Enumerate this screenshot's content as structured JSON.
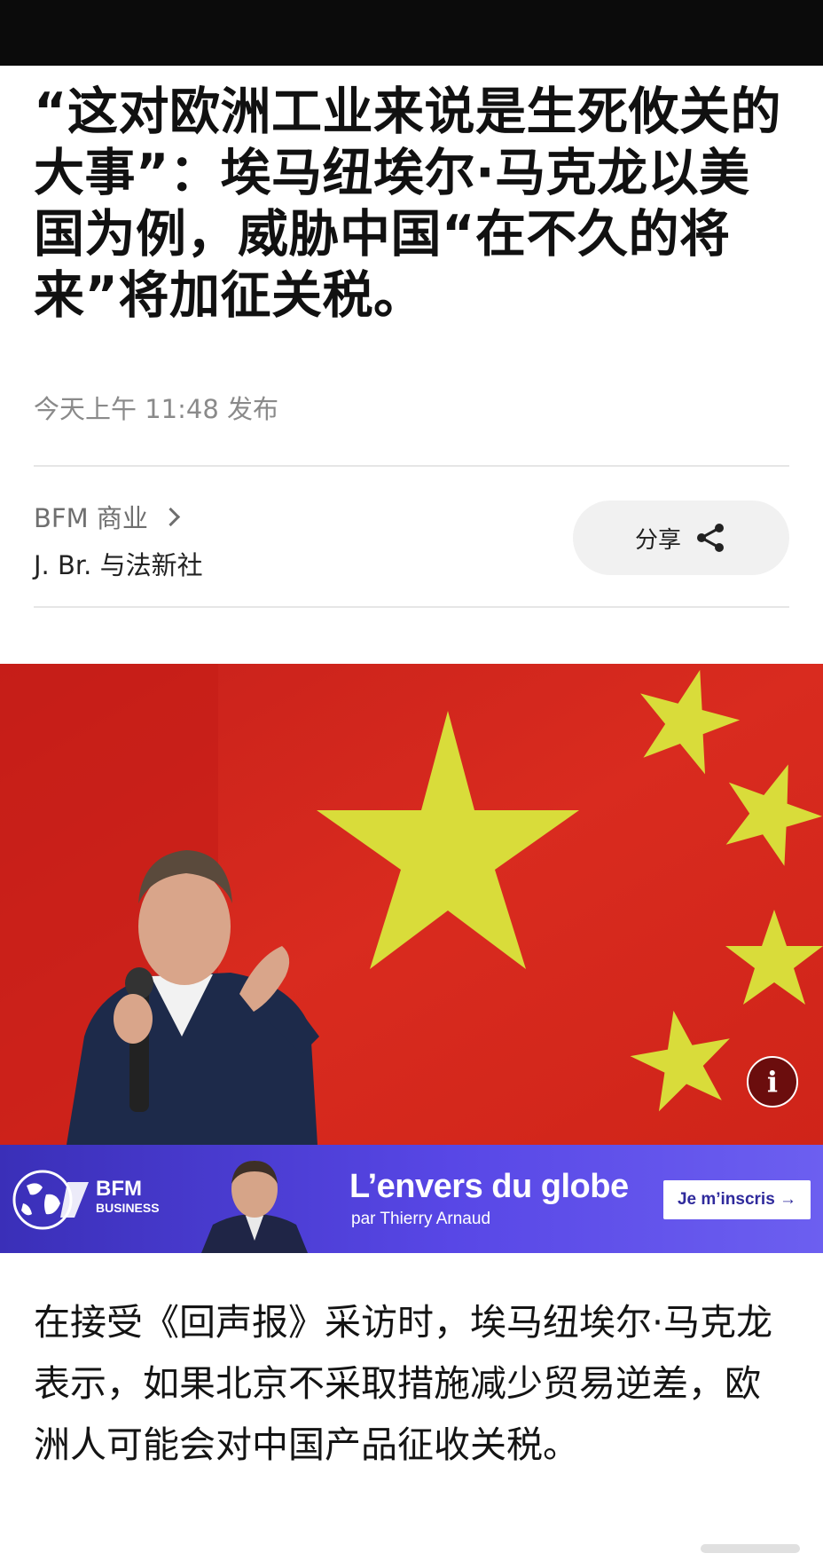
{
  "article": {
    "headline": "“这对欧洲工业来说是生死攸关的大事”：埃马纽埃尔·马克龙以美国为例，威胁中国“在不久的将来”将加征关税。",
    "published": "今天上午 11:48 发布",
    "source": "BFM 商业",
    "byline": "J. Br. 与法新社",
    "body": "在接受《回声报》采访时，埃马纽埃尔·马克龙表示，如果北京不采取措施减少贸易逆差，欧洲人可能会对中国产品征收关税。"
  },
  "share": {
    "label": "分享",
    "icon": "share-icon"
  },
  "hero_image": {
    "info_label": "i",
    "colors": {
      "flag_red": "#d62a1e",
      "star_yellow": "#d9dc3a"
    }
  },
  "banner": {
    "logo_line1": "BFM",
    "logo_line2": "BUSINESS",
    "title": "L’envers du globe",
    "subtitle": "par Thierry Arnaud",
    "cta": "Je m’inscris →",
    "colors": {
      "background": "#4b3fd6",
      "cta_text": "#2f2a9c"
    }
  }
}
